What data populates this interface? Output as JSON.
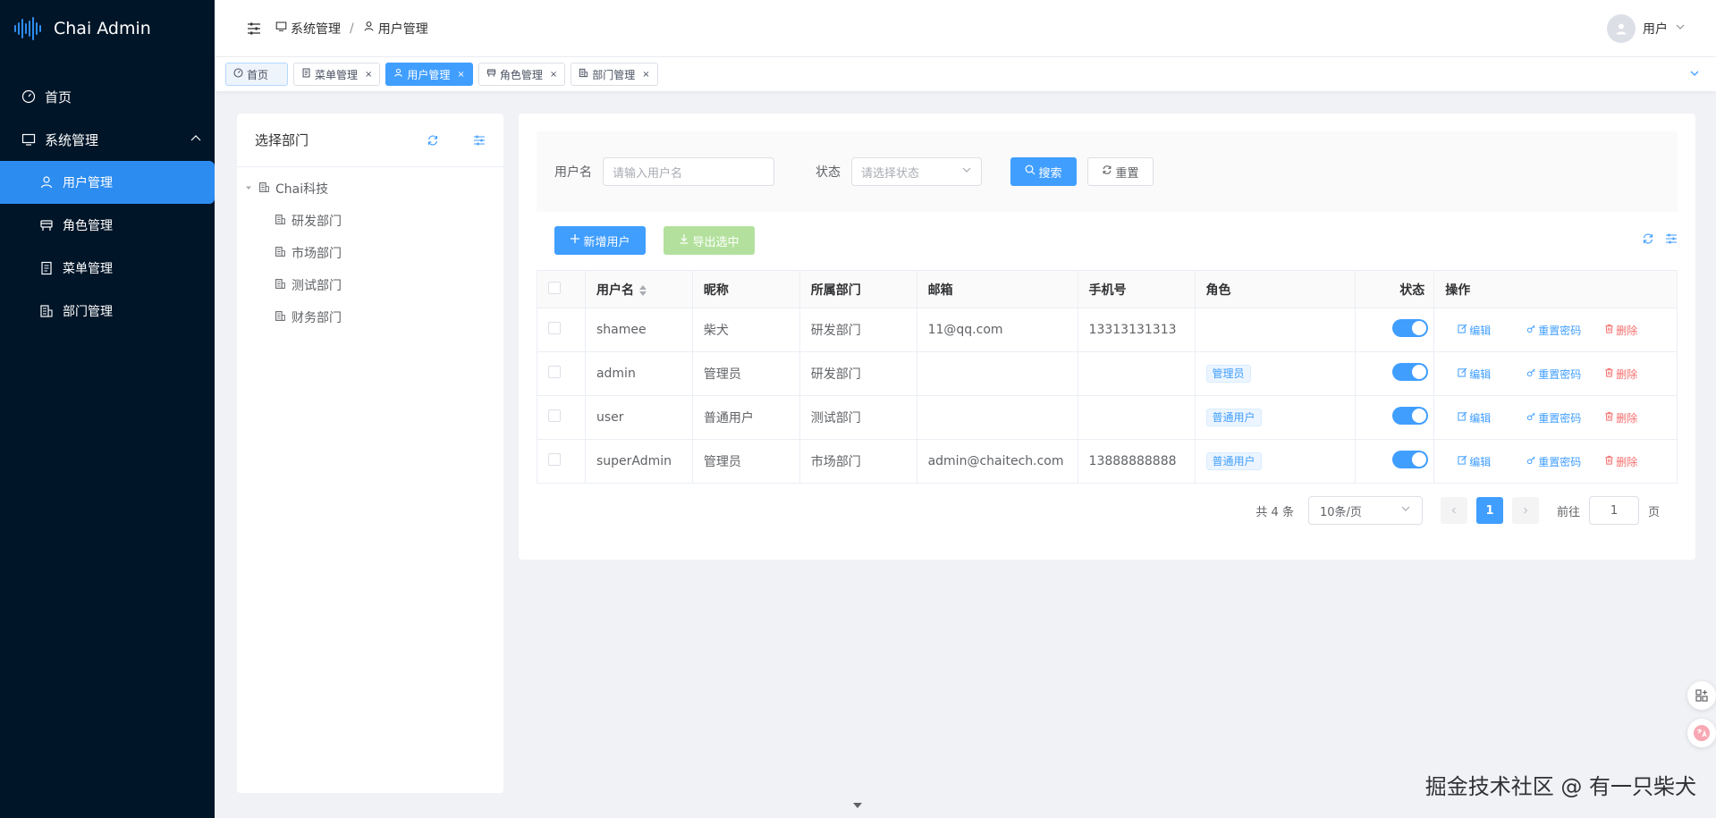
{
  "app": {
    "title": "Chai Admin"
  },
  "sidebar": {
    "items": [
      {
        "label": "首页",
        "icon": "dashboard-icon"
      },
      {
        "label": "系统管理",
        "icon": "monitor-icon",
        "expanded": true
      }
    ],
    "submenu": [
      {
        "label": "用户管理",
        "icon": "user-icon",
        "active": true
      },
      {
        "label": "角色管理",
        "icon": "role-icon"
      },
      {
        "label": "菜单管理",
        "icon": "document-icon"
      },
      {
        "label": "部门管理",
        "icon": "building-icon"
      }
    ]
  },
  "header": {
    "breadcrumb": [
      "系统管理",
      "用户管理"
    ],
    "breadcrumb_sep": "/",
    "user_name": "用户"
  },
  "tabs": [
    {
      "label": "首页"
    },
    {
      "label": "菜单管理",
      "close": "×"
    },
    {
      "label": "用户管理",
      "close": "×",
      "active": true
    },
    {
      "label": "角色管理",
      "close": "×"
    },
    {
      "label": "部门管理",
      "close": "×"
    }
  ],
  "dept": {
    "title": "选择部门",
    "root": "Chai科技",
    "children": [
      "研发部门",
      "市场部门",
      "测试部门",
      "财务部门"
    ]
  },
  "search": {
    "username_label": "用户名",
    "username_placeholder": "请输入用户名",
    "status_label": "状态",
    "status_placeholder": "请选择状态",
    "search_btn": "搜索",
    "reset_btn": "重置"
  },
  "toolbar": {
    "add_btn": "新增用户",
    "export_btn": "导出选中"
  },
  "table": {
    "columns": [
      "用户名",
      "昵称",
      "所属部门",
      "邮箱",
      "手机号",
      "角色",
      "状态",
      "操作"
    ],
    "rows": [
      {
        "username": "shamee",
        "nickname": "柴犬",
        "dept": "研发部门",
        "email": "11@qq.com",
        "phone": "13313131313",
        "role": "",
        "status": true
      },
      {
        "username": "admin",
        "nickname": "管理员",
        "dept": "研发部门",
        "email": "",
        "phone": "",
        "role": "管理员",
        "status": true
      },
      {
        "username": "user",
        "nickname": "普通用户",
        "dept": "测试部门",
        "email": "",
        "phone": "",
        "role": "普通用户",
        "status": true
      },
      {
        "username": "superAdmin",
        "nickname": "管理员",
        "dept": "市场部门",
        "email": "admin@chaitech.com",
        "phone": "13888888888",
        "role": "普通用户",
        "status": true
      }
    ],
    "ops": {
      "edit": "编辑",
      "reset_pwd": "重置密码",
      "delete": "删除"
    }
  },
  "pager": {
    "total": "共 4 条",
    "page_size": "10条/页",
    "current": "1",
    "goto_label": "前往",
    "goto_value": "1",
    "page_unit": "页"
  },
  "watermark": "掘金技术社区 @ 有一只柴犬",
  "colors": {
    "sidebar_bg": "#011528",
    "primary": "#409eff",
    "danger": "#f56c6c",
    "success_disabled": "#b3e19d"
  }
}
